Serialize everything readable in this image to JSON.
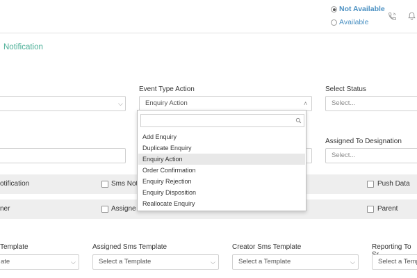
{
  "header": {
    "availability": [
      {
        "label": "Not Available",
        "selected": true
      },
      {
        "label": "Available",
        "selected": false
      }
    ],
    "icons": [
      "phone-icon",
      "bell-icon"
    ],
    "accent_color": "#4a90c2"
  },
  "page": {
    "title": "Notification",
    "title_color": "#4caf97"
  },
  "row1": {
    "event_type_action_label": "Event Type Action",
    "event_type_action_value": "Enquiry Action",
    "select_status_label": "Select Status",
    "select_status_placeholder": "Select..."
  },
  "row2": {
    "assigned_to_designation_label": "Assigned To Designation",
    "assigned_to_designation_placeholder": "Select..."
  },
  "dropdown": {
    "search_value": "",
    "options": [
      "Add Enquiry",
      "Duplicate Enquiry",
      "Enquiry Action",
      "Order Confirmation",
      "Enquiry Rejection",
      "Enquiry Disposition",
      "Reallocate Enquiry"
    ],
    "selected": "Enquiry Action"
  },
  "band1": {
    "left_label": "otification",
    "sms_label": "Sms Noti",
    "push_label": "Push Data"
  },
  "band2": {
    "left_label": "ner",
    "assigned_label": "Assigne",
    "parent_label": "Parent"
  },
  "templates": {
    "col1_label": "Template",
    "col1_value": "ate",
    "col2_label": "Assigned Sms Template",
    "col2_value": "Select a Template",
    "col3_label": "Creator Sms Template",
    "col3_value": "Select a Template",
    "col4_label": "Reporting To Sr",
    "col4_value": "Select a Templa"
  }
}
